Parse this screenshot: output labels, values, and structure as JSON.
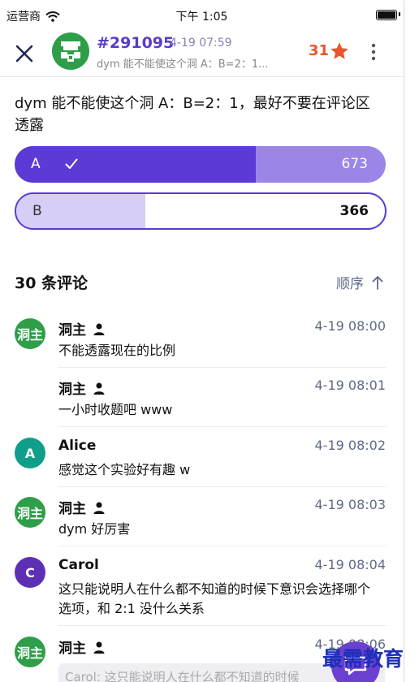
{
  "status_bar": {
    "carrier": "运营商",
    "time": "下午 1:05"
  },
  "header": {
    "post_id": "#291095",
    "post_time": "4-19 07:59",
    "post_preview": "dym 能不能使这个洞 A：B=2：1...",
    "star_count": "31"
  },
  "post": {
    "text": "dym 能不能使这个洞 A：B=2：1，最好不要在评论区透露",
    "poll": {
      "options": [
        {
          "label": "A",
          "votes": "673",
          "selected": true,
          "fraction": 0.65
        },
        {
          "label": "B",
          "votes": "366",
          "selected": false,
          "fraction": 0.35
        }
      ]
    }
  },
  "comments_header": {
    "title": "30 条评论",
    "sort_label": "顺序"
  },
  "colors": {
    "accent": "#5b3ad6",
    "star": "#e8562c",
    "owner_avatar": "#2e9e49",
    "alice_avatar": "#0f9e8a",
    "carol_avatar": "#5d2fb5"
  },
  "comments": [
    {
      "avatar": "洞主",
      "name": "洞主",
      "owner": true,
      "time": "4-19 08:00",
      "text": "不能透露现在的比例"
    },
    {
      "avatar": "",
      "name": "洞主",
      "owner": true,
      "time": "4-19 08:01",
      "text": "一小时收题吧 www"
    },
    {
      "avatar": "A",
      "name": "Alice",
      "owner": false,
      "time": "4-19 08:02",
      "text": "感觉这个实验好有趣 w"
    },
    {
      "avatar": "洞主",
      "name": "洞主",
      "owner": true,
      "time": "4-19 08:03",
      "text": "dym 好厉害"
    },
    {
      "avatar": "C",
      "name": "Carol",
      "owner": false,
      "time": "4-19 08:04",
      "text": "这只能说明人在什么都不知道的时候下意识会选择哪个选项，和 2:1 没什么关系"
    },
    {
      "avatar": "洞主",
      "name": "洞主",
      "owner": true,
      "time": "4-19 08:06",
      "text": ""
    }
  ],
  "quote_preview": "Carol: 这只能说明人在什么都不知道的时候",
  "watermark": "最需教育"
}
